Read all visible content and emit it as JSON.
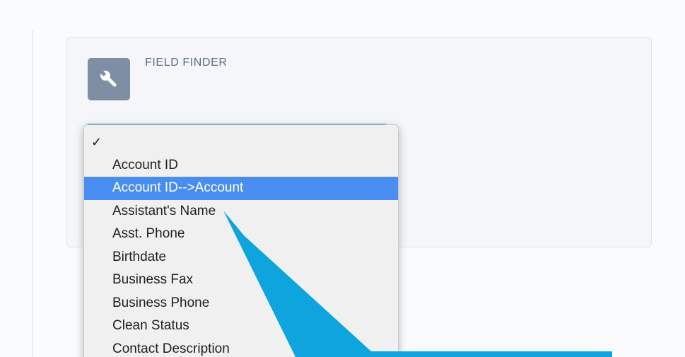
{
  "field_finder": {
    "title": "FIELD FINDER",
    "icon": "wrench-icon"
  },
  "dropdown": {
    "checked_item": 0,
    "highlighted_item": 2,
    "items": [
      "",
      "Account ID",
      "Account ID-->Account",
      "Assistant's Name",
      "Asst. Phone",
      "Birthdate",
      "Business Fax",
      "Business Phone",
      "Clean Status",
      "Contact Description"
    ]
  },
  "colors": {
    "highlight": "#4a8df1",
    "annotation_arrow": "#0ea5df",
    "icon_tile": "#7e8ea3"
  }
}
